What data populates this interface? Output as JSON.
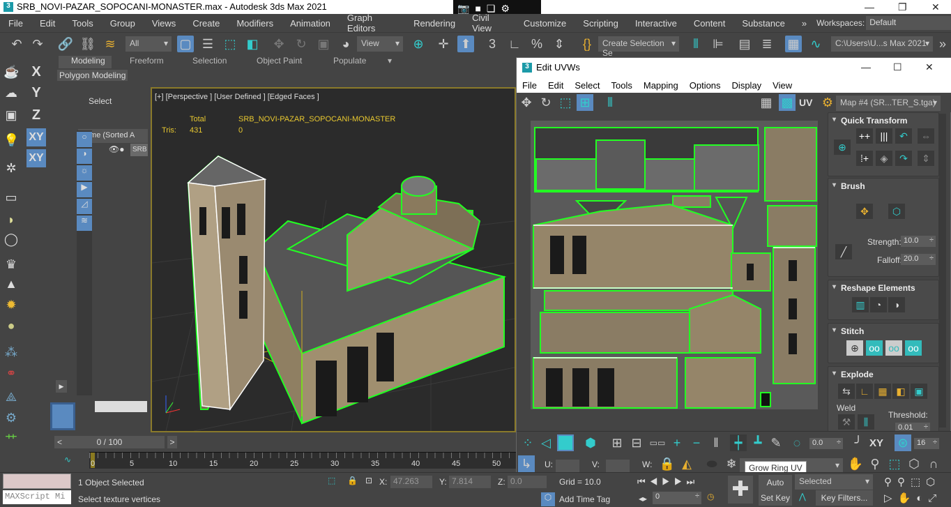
{
  "title": "SRB_NOVI-PAZAR_SOPOCANI-MONASTER.max - Autodesk 3ds Max 2021",
  "menu": [
    "File",
    "Edit",
    "Tools",
    "Group",
    "Views",
    "Create",
    "Modifiers",
    "Animation",
    "Graph Editors",
    "Rendering",
    "Civil View",
    "Customize",
    "Scripting",
    "Interactive",
    "Content",
    "Substance"
  ],
  "workspaces_label": "Workspaces:",
  "workspace": "Default",
  "toolbar": {
    "filter": "All",
    "ref_coord": "View",
    "selection_set": "Create Selection Se",
    "project_path": "C:\\Users\\U...s Max 2021"
  },
  "ribbon": {
    "tabs": [
      "Modeling",
      "Freeform",
      "Selection",
      "Object Paint",
      "Populate"
    ],
    "panel": "Polygon Modeling"
  },
  "axes": [
    "X",
    "Y",
    "Z",
    "XY",
    "XY"
  ],
  "explorer": {
    "select": "Select",
    "column": "Name (Sorted A",
    "item": "SRB"
  },
  "viewport": {
    "label": "[+] [Perspective ] [User Defined ] [Edged Faces ]",
    "stats_total": "Total",
    "stats_object": "SRB_NOVI-PAZAR_SOPOCANI-MONASTER",
    "tris_label": "Tris:",
    "tris_total": "431",
    "tris_object": "0"
  },
  "uvw": {
    "title": "Edit UVWs",
    "menu": [
      "File",
      "Edit",
      "Select",
      "Tools",
      "Mapping",
      "Options",
      "Display",
      "View"
    ],
    "uv_label": "UV",
    "map": "Map #4 (SR...TER_S.tga)",
    "rollouts": {
      "quick_transform": "Quick Transform",
      "brush": "Brush",
      "strength_label": "Strength:",
      "strength": "10.0",
      "falloff_label": "Falloff:",
      "falloff": "20.0",
      "reshape": "Reshape Elements",
      "stitch": "Stitch",
      "explode": "Explode",
      "weld": "Weld",
      "threshold_label": "Threshold:",
      "threshold": "0.01"
    },
    "bottom": {
      "angle": "0.0",
      "xy": "XY",
      "count": "16",
      "u_label": "U:",
      "v_label": "V:",
      "w_label": "W:"
    },
    "tooltip": "Grow Ring UV"
  },
  "timeline": {
    "frame": "0 / 100",
    "ticks": [
      "0",
      "5",
      "10",
      "15",
      "20",
      "25",
      "30",
      "35",
      "40",
      "45",
      "50"
    ]
  },
  "status": {
    "maxscript": "MAXScript Mi",
    "selected": "1 Object Selected",
    "prompt": "Select texture vertices",
    "x_label": "X:",
    "x": "47.263",
    "y_label": "Y:",
    "y": "7.814",
    "z_label": "Z:",
    "z": "0.0",
    "grid": "Grid = 10.0",
    "add_time_tag": "Add Time Tag",
    "auto_key": "Auto Key",
    "key_mode": "Selected",
    "set_key": "Set Key",
    "key_filters": "Key Filters...",
    "current_frame": "0",
    "frame_field": "0"
  }
}
